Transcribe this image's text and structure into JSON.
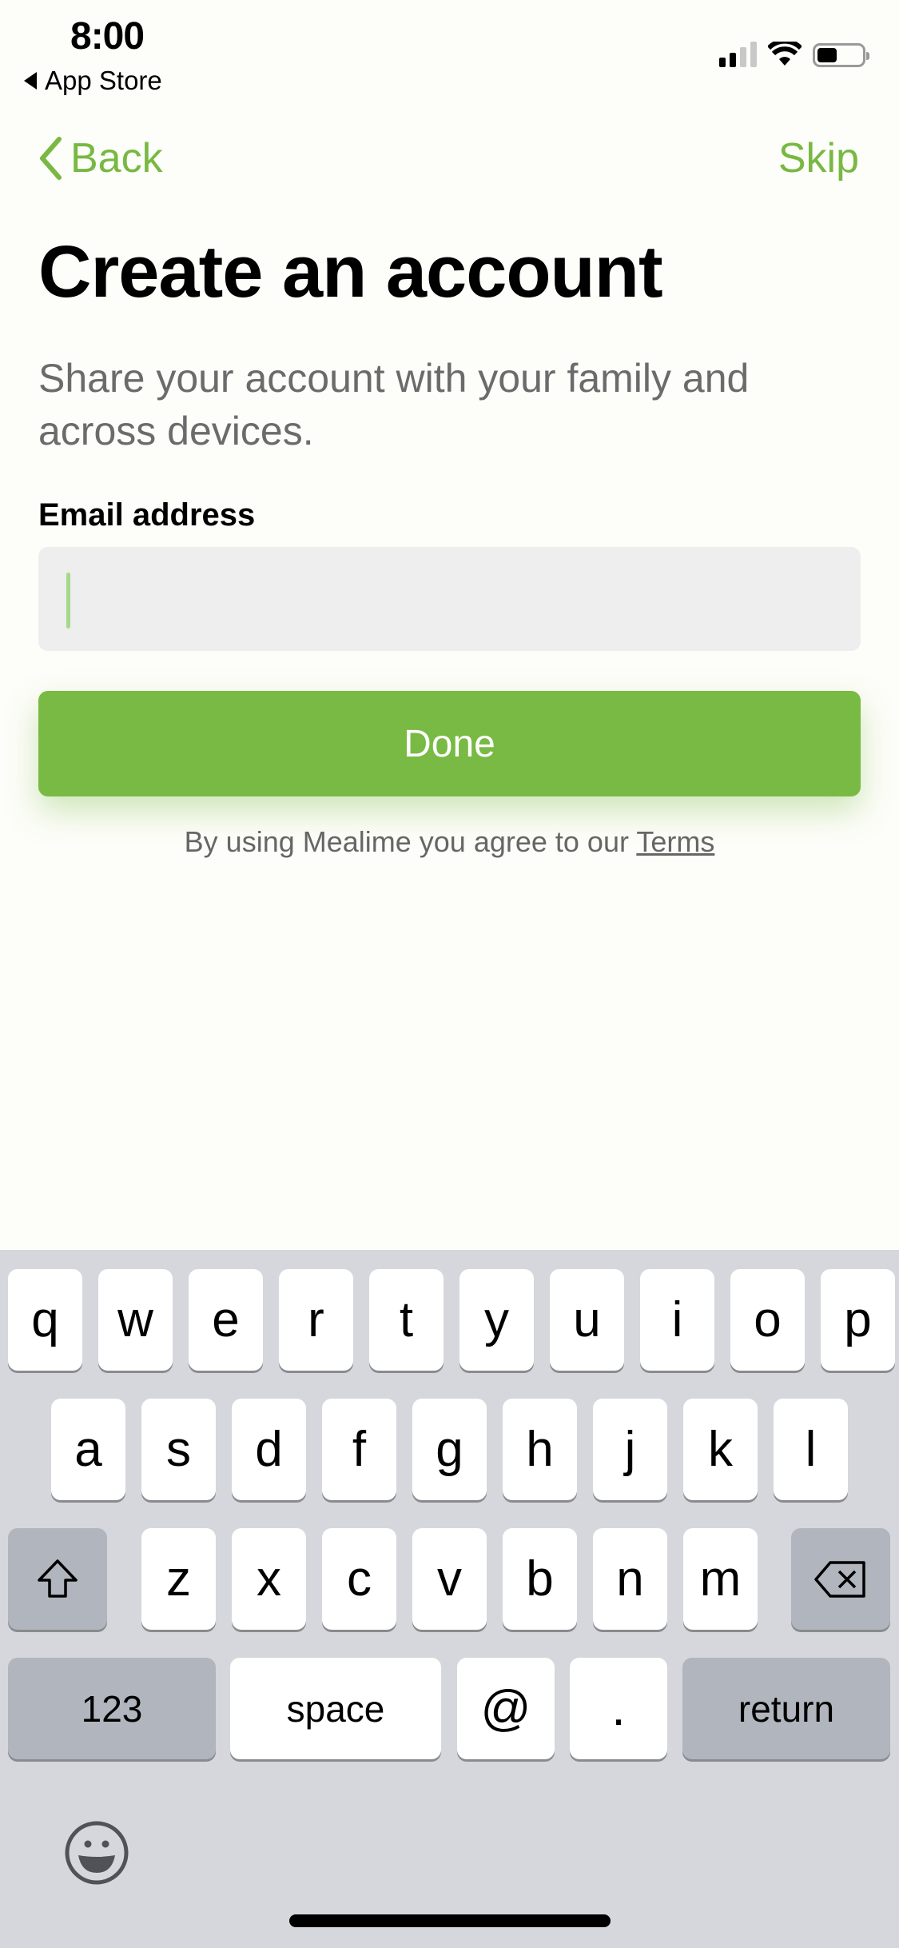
{
  "status_bar": {
    "time": "8:00",
    "back_app": "App Store",
    "battery_level": 0.45,
    "signal_bars": 2
  },
  "nav": {
    "back_label": "Back",
    "skip_label": "Skip"
  },
  "page": {
    "title": "Create an account",
    "subtitle": "Share your account with your family and across devices.",
    "email_label": "Email address",
    "email_value": "",
    "email_placeholder": "",
    "done_label": "Done",
    "terms_prefix": "By using Mealime you agree to our ",
    "terms_link": "Terms"
  },
  "colors": {
    "accent": "#78b843",
    "button": "#78ba43",
    "input_bg": "#eeeeee",
    "keyboard_bg": "#d5d7dc"
  },
  "keyboard": {
    "row1": [
      "q",
      "w",
      "e",
      "r",
      "t",
      "y",
      "u",
      "i",
      "o",
      "p"
    ],
    "row2": [
      "a",
      "s",
      "d",
      "f",
      "g",
      "h",
      "j",
      "k",
      "l"
    ],
    "row3": [
      "z",
      "x",
      "c",
      "v",
      "b",
      "n",
      "m"
    ],
    "numbers_label": "123",
    "space_label": "space",
    "at_label": "@",
    "dot_label": ".",
    "return_label": "return",
    "shift_icon": "shift-icon",
    "delete_icon": "delete-icon",
    "emoji_icon": "emoji-icon"
  }
}
